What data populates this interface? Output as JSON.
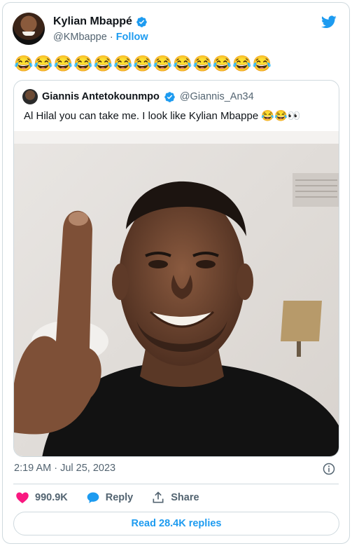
{
  "author": {
    "name": "Kylian Mbappé",
    "handle": "@KMbappe",
    "separator": "·",
    "follow_label": "Follow"
  },
  "tweet": {
    "text": "😂😂😂😂😂😂😂😂😂😂😂😂😂"
  },
  "quoted": {
    "name": "Giannis Antetokounmpo",
    "handle": "@Giannis_An34",
    "text": "Al Hilal you can take me. I look like Kylian Mbappe 😂😂👀"
  },
  "footer": {
    "timestamp": "2:19 AM · Jul 25, 2023",
    "likes": "990.9K",
    "reply_label": "Reply",
    "share_label": "Share",
    "read_replies_label": "Read 28.4K replies"
  },
  "colors": {
    "accent": "#1d9bf0",
    "like": "#f91880",
    "muted": "#536471",
    "border": "#cfd9de"
  },
  "icons": [
    "verified-badge-icon",
    "twitter-bird-icon",
    "info-icon",
    "heart-icon",
    "reply-bubble-icon",
    "share-icon"
  ]
}
